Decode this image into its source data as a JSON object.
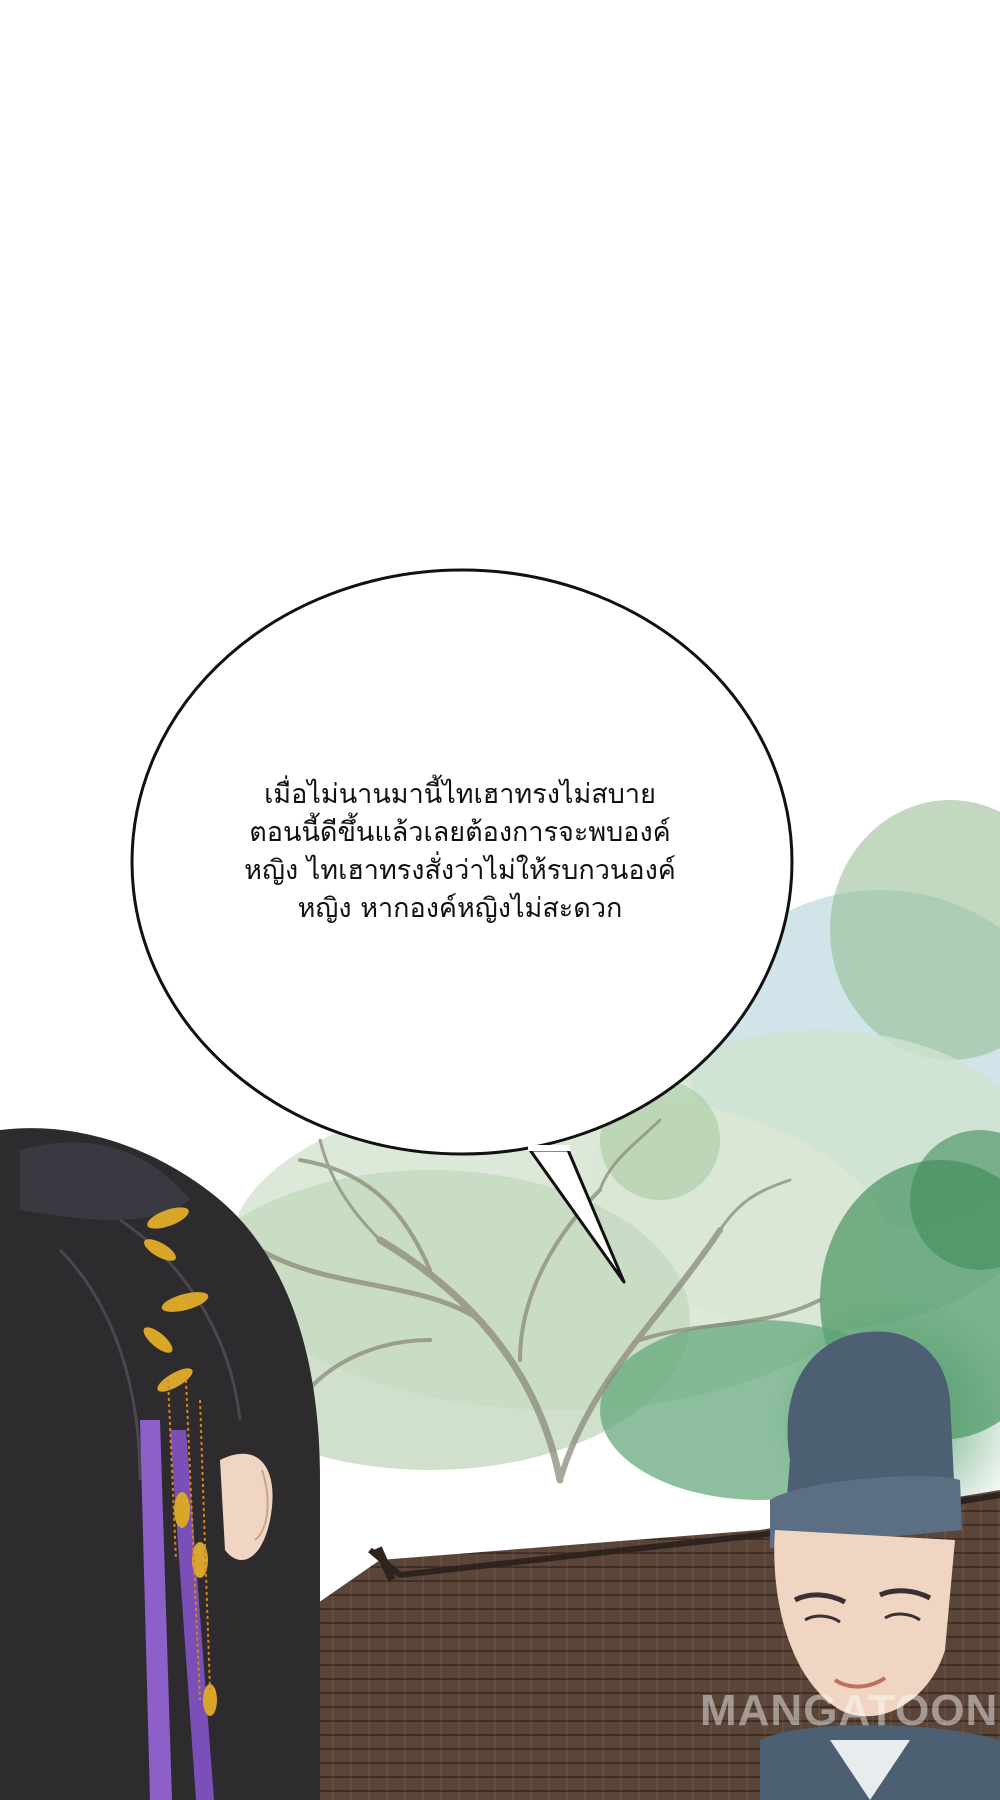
{
  "speech_bubble": {
    "lines": [
      "เมื่อไม่นานมานี้ไทเฮาทรงไม่สบาย",
      "ตอนนี้ดีขึ้นแล้วเลยต้องการจะพบองค์",
      "หญิง ไทเฮาทรงสั่งว่าไม่ให้รบกวนองค์",
      "หญิง หากองค์หญิงไม่สะดวก"
    ]
  },
  "watermark": "MANGATOON",
  "colors": {
    "background": "#ffffff",
    "foliage_light": "#cfe3cf",
    "foliage_mid": "#8fb98c",
    "foliage_dark": "#4f9a68",
    "sky_blue": "#a9cdd8",
    "branches": "#8b8a78",
    "roof": "#5a4538",
    "hair": "#2d2b2e",
    "hair_ribbon": "#8c5fc9",
    "gold_ornament": "#d9a62a",
    "hat": "#4d5f72",
    "skin": "#f0d6c2"
  }
}
